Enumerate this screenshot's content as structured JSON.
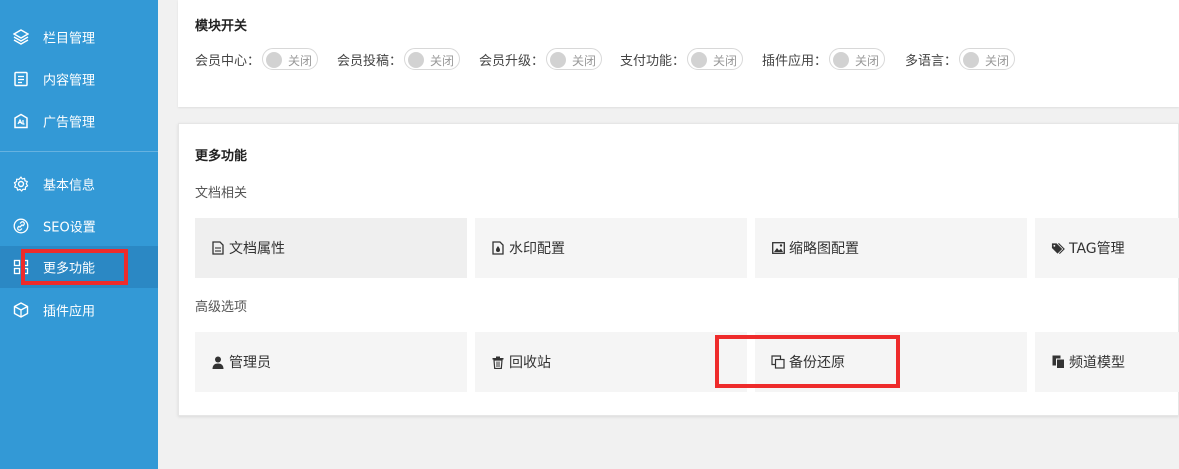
{
  "sidebar": {
    "items": [
      {
        "label": "栏目管理",
        "icon": "layers-icon"
      },
      {
        "label": "内容管理",
        "icon": "document-icon"
      },
      {
        "label": "广告管理",
        "icon": "ad-icon"
      },
      {
        "label": "基本信息",
        "icon": "gear-icon"
      },
      {
        "label": "SEO设置",
        "icon": "link-icon"
      },
      {
        "label": "更多功能",
        "icon": "grid-icon"
      },
      {
        "label": "插件应用",
        "icon": "cube-icon"
      }
    ]
  },
  "modules": {
    "title": "模块开关",
    "items": [
      {
        "label": "会员中心：",
        "state": "关闭"
      },
      {
        "label": "会员投稿：",
        "state": "关闭"
      },
      {
        "label": "会员升级：",
        "state": "关闭"
      },
      {
        "label": "支付功能：",
        "state": "关闭"
      },
      {
        "label": "插件应用：",
        "state": "关闭"
      },
      {
        "label": "多语言：",
        "state": "关闭"
      }
    ]
  },
  "more": {
    "title": "更多功能",
    "doc_section": {
      "title": "文档相关",
      "tiles": [
        {
          "label": "文档属性",
          "icon": "file-icon"
        },
        {
          "label": "水印配置",
          "icon": "watermark-icon"
        },
        {
          "label": "缩略图配置",
          "icon": "image-icon"
        },
        {
          "label": "TAG管理",
          "icon": "tags-icon"
        }
      ]
    },
    "adv_section": {
      "title": "高级选项",
      "tiles": [
        {
          "label": "管理员",
          "icon": "user-icon"
        },
        {
          "label": "回收站",
          "icon": "trash-icon"
        },
        {
          "label": "备份还原",
          "icon": "copy-icon"
        },
        {
          "label": "频道模型",
          "icon": "clone-icon"
        }
      ]
    }
  },
  "colors": {
    "sidebar_bg": "#3399d6",
    "sidebar_active": "#2b88c4",
    "highlight_box": "#ee2b2b"
  }
}
